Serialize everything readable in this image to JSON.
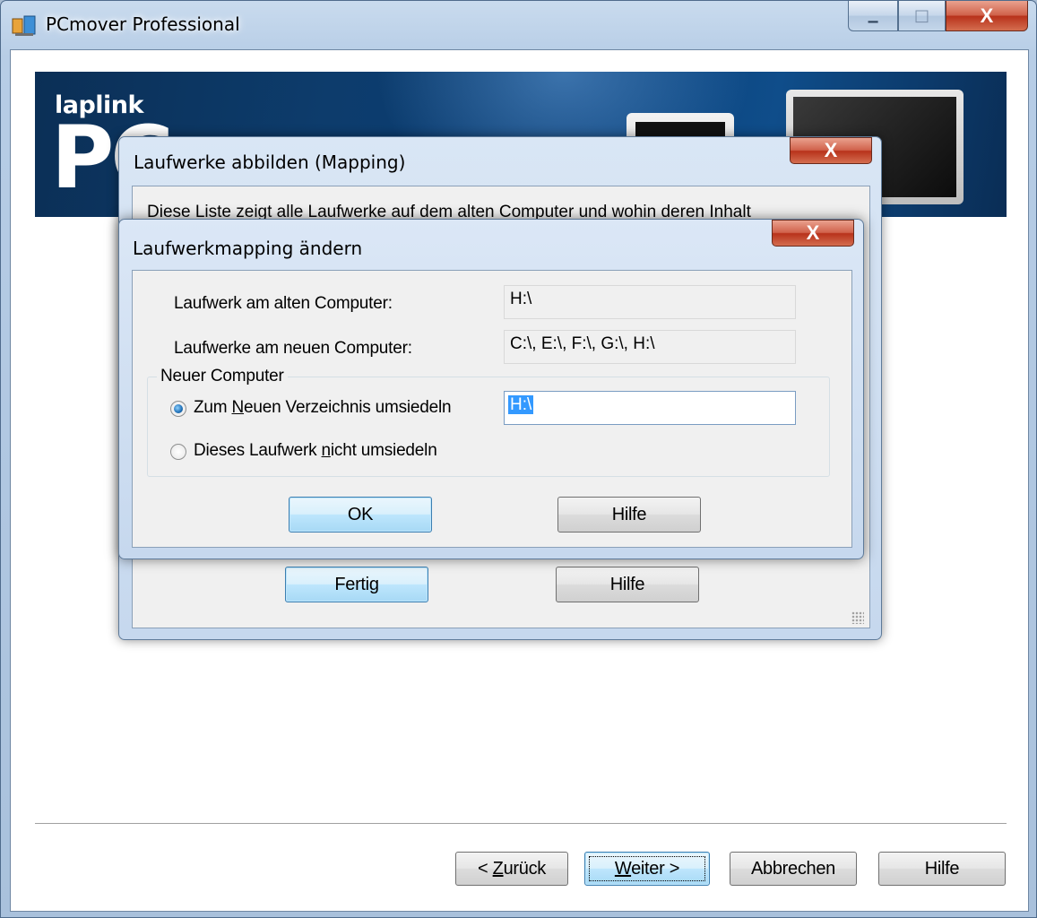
{
  "window": {
    "title": "PCmover Professional",
    "minimize_glyph": "▁",
    "maximize_glyph": "□",
    "close_glyph": "X"
  },
  "banner": {
    "brand_small": "laplink",
    "brand_large": "PC"
  },
  "mapping_dialog": {
    "title": "Laufwerke abbilden (Mapping)",
    "description": "Diese Liste zeigt alle Laufwerke auf dem alten Computer und wohin deren Inhalt",
    "close_glyph": "X",
    "done_label": "Fertig",
    "help_label": "Hilfe"
  },
  "change_dialog": {
    "title": "Laufwerkmapping ändern",
    "close_glyph": "X",
    "old_drive_label": "Laufwerk am alten Computer:",
    "old_drive_value": "H:\\",
    "new_drives_label": "Laufwerke am neuen Computer:",
    "new_drives_value": "C:\\, E:\\, F:\\, G:\\, H:\\",
    "group_label": "Neuer Computer",
    "option_relocate": {
      "prefix": "Zum ",
      "mnemonic": "N",
      "suffix": "euen Verzeichnis umsiedeln",
      "selected": true
    },
    "option_skip": {
      "prefix": "Dieses Laufwerk ",
      "mnemonic": "n",
      "suffix": "icht umsiedeln",
      "selected": false
    },
    "target_value": "H:\\",
    "ok_label": "OK",
    "help_label": "Hilfe"
  },
  "wizard_nav": {
    "back_mnemonic": "Z",
    "back_prefix": "< ",
    "back_suffix": "urück",
    "next_mnemonic": "W",
    "next_suffix": "eiter >",
    "cancel_label": "Abbrechen",
    "help_label": "Hilfe"
  },
  "colors": {
    "aero_frame": "#b7cde6",
    "close_red": "#c9452c",
    "banner_blue": "#0d3c6c",
    "selection_blue": "#3399ff",
    "default_button_border": "#3c7fb1"
  }
}
